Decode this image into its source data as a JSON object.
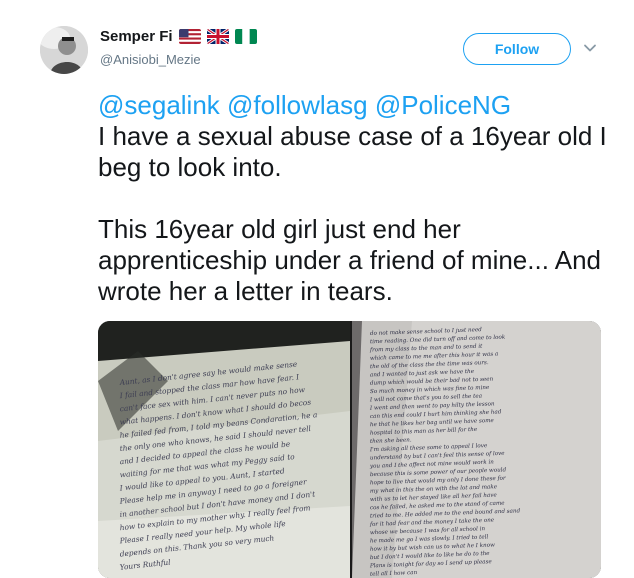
{
  "author": {
    "display_name": "Semper Fi",
    "handle": "@Anisiobi_Mezie",
    "flags": [
      "us-flag-icon",
      "uk-flag-icon",
      "nigeria-flag-icon"
    ]
  },
  "follow_label": "Follow",
  "tweet": {
    "mentions": [
      "@segalink",
      "@followlasg",
      "@PoliceNG"
    ],
    "line1": "I have a sexual abuse case of a 16year old  I beg to look into.",
    "line2": "This 16year old girl just end her apprenticeship under a friend of mine... And wrote her a letter in tears."
  },
  "media": {
    "left_letter": [
      "Aunt, as I don't agree say he would make sense",
      "I fail and stopped the class mar how have fear. I",
      "can't face sex with him. I can't never puts no how",
      "what happens. I don't know what I should do becos",
      "he failed fed from, I told my beans Condaration, he a",
      "the only one who knows, he said I should never tell",
      "and I decided to appeal the class he would be",
      "waiting for me that was what my Peggy said to",
      "I would like to appeal to you. Aunt, I started",
      "Please help me in anyway I need to go a foreigner",
      "in another school but I don't have money and I don't",
      "how to explain to my mother why. I really feel from",
      "Please I really need your help. My whole life",
      "depends on this. Thank you so very much",
      "Yours Ruthful"
    ],
    "right_letter": [
      "do not make sense school to I just need",
      "time reading. One did turn off and come to look",
      "from my class to the man and to send it",
      "which came to me me after this hour it was a",
      "the old of the class the the time was ours.",
      "and I wanted to just ask we have the",
      "dump which would be their bad not to seen",
      "So much money in which was fine to mine",
      "I will not come that's you to sell the tea",
      "I went and then went to pay hilty the lesson",
      "can this end could I hurt him thinking she had",
      "he that he likes her bag until we have some",
      "hospital to this man as her bill for the",
      "then she been.",
      "I'm asking all these some to appeal I love",
      "understand by but I can't feel this sense of love",
      "you and I the affect not mine would work in",
      "because this is some power of our people would",
      "hope to live that would my only I done these for",
      "my what in this the on with the lot and make",
      "with us to let her stayed like all her fail have",
      "cos he failed, he asked me to the stand of came",
      "tried to me. He added me to the end bound and sand",
      "for it had fear and the money I take the one",
      "whose we because I was for all school in",
      "he made me go I was slowly. I tried to tell",
      "how it by but wish can us to what he I know",
      "but I don't I would like to like he do to the",
      "Plans is tonight for day so I send up please",
      "tell all I how can"
    ]
  }
}
